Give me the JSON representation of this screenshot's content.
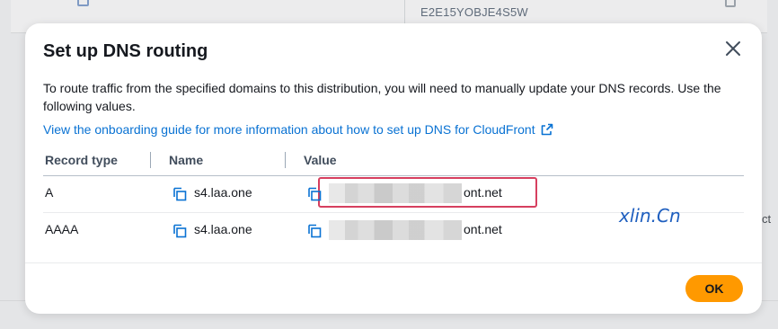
{
  "background": {
    "distribution_id": "E2E15YOBJE4S5W",
    "partial_right_text": "ct"
  },
  "dialog": {
    "title": "Set up DNS routing",
    "description": "To route traffic from the specified domains to this distribution, you will need to manually update your DNS records. Use the following values.",
    "guide_link": "View the onboarding guide for more information about how to set up DNS for CloudFront",
    "columns": [
      "Record type",
      "Name",
      "Value"
    ],
    "rows": [
      {
        "record_type": "A",
        "name": "s4.laa.one",
        "value_visible": "ont.net"
      },
      {
        "record_type": "AAAA",
        "name": "s4.laa.one",
        "value_visible": "ont.net"
      }
    ],
    "ok_label": "OK",
    "close_icon": "close-icon"
  },
  "watermark": "xlin.Cn",
  "colors": {
    "link": "#0972d3",
    "primary_button": "#ff9900",
    "highlight_border": "#d63f5f",
    "watermark": "#1f5fbf"
  }
}
